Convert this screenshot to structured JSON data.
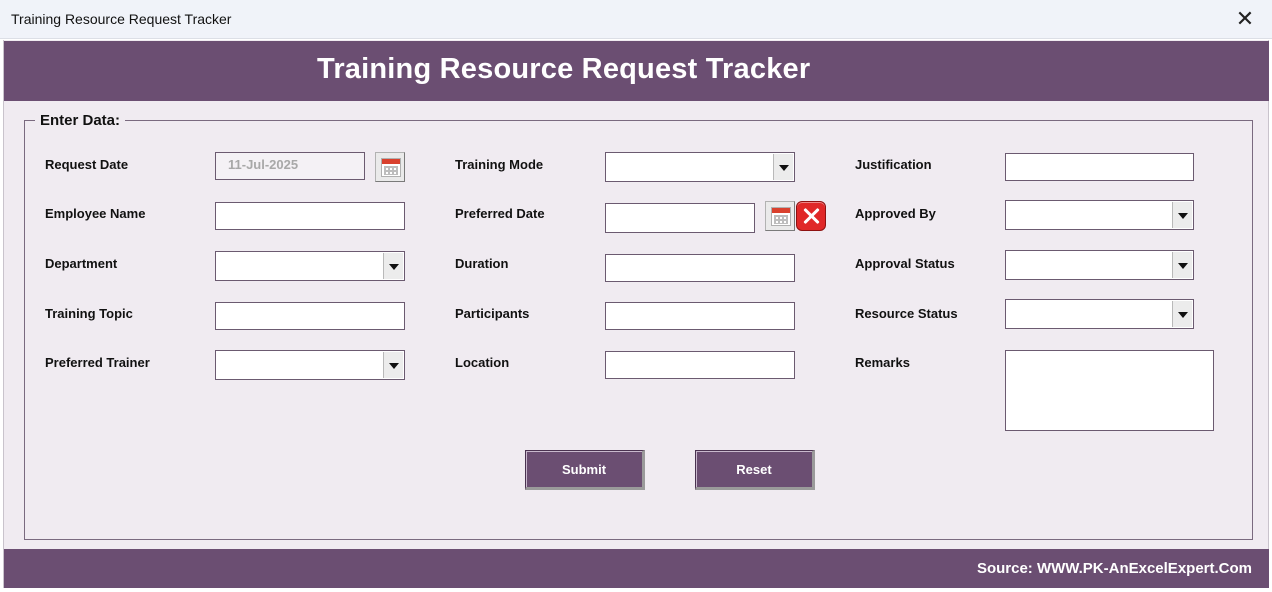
{
  "window": {
    "title": "Training Resource Request Tracker",
    "close_icon": "close-icon"
  },
  "header": {
    "title": "Training Resource Request Tracker"
  },
  "frame": {
    "legend": "Enter Data:"
  },
  "fields": {
    "request_date": {
      "label": "Request Date",
      "value": "11-Jul-2025"
    },
    "employee_name": {
      "label": "Employee Name",
      "value": ""
    },
    "department": {
      "label": "Department",
      "value": ""
    },
    "training_topic": {
      "label": "Training Topic",
      "value": ""
    },
    "preferred_trainer": {
      "label": "Preferred Trainer",
      "value": ""
    },
    "training_mode": {
      "label": "Training Mode",
      "value": ""
    },
    "preferred_date": {
      "label": "Preferred Date",
      "value": ""
    },
    "duration": {
      "label": "Duration",
      "value": ""
    },
    "participants": {
      "label": "Participants",
      "value": ""
    },
    "location": {
      "label": "Location",
      "value": ""
    },
    "justification": {
      "label": "Justification",
      "value": ""
    },
    "approved_by": {
      "label": "Approved By",
      "value": ""
    },
    "approval_status": {
      "label": "Approval Status",
      "value": ""
    },
    "resource_status": {
      "label": "Resource Status",
      "value": ""
    },
    "remarks": {
      "label": "Remarks",
      "value": ""
    }
  },
  "buttons": {
    "submit": "Submit",
    "reset": "Reset"
  },
  "footer": {
    "source": "Source: WWW.PK-AnExcelExpert.Com"
  },
  "colors": {
    "accent": "#6b4e72",
    "form_bg": "#f0ebf1",
    "clear_red": "#e02828"
  }
}
